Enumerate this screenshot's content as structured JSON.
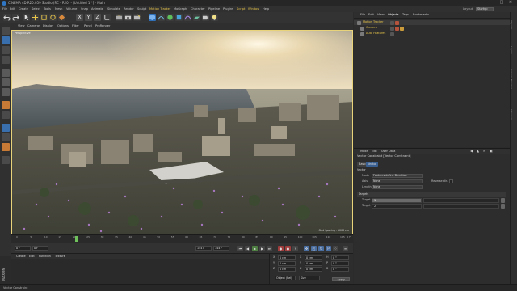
{
  "window": {
    "title": "CINEMA 4D R20.059 Studio (RC - R20) - [Untitled 1 *] - Main",
    "minimize": "–",
    "maximize": "□",
    "close": "×"
  },
  "menubar": {
    "items": [
      "File",
      "Edit",
      "Create",
      "Select",
      "Tools",
      "Mesh",
      "Volume",
      "Snap",
      "Animate",
      "Simulate",
      "Render",
      "Sculpt",
      "Motion Tracker",
      "MoGraph",
      "Character",
      "Pipeline",
      "Plugins",
      "Script",
      "Window",
      "Help"
    ],
    "highlighted": [
      "Motion Tracker",
      "Script",
      "Window"
    ],
    "layout_label": "Layout:",
    "layout_value": "Startup"
  },
  "toolbar": {
    "axis_x": "X",
    "axis_y": "Y",
    "axis_z": "Z"
  },
  "viewport": {
    "menu": [
      "View",
      "Cameras",
      "Display",
      "Options",
      "Filter",
      "Panel",
      "ProRender"
    ],
    "camera_label": "Perspective",
    "grid_spacing": "Grid Spacing : 1000 cm"
  },
  "timeline": {
    "ticks": [
      "0",
      "5",
      "10",
      "15",
      "20",
      "25",
      "30",
      "35",
      "40",
      "45",
      "50",
      "55",
      "60",
      "65",
      "70",
      "75",
      "80",
      "85",
      "90",
      "95",
      "100",
      "105",
      "110",
      "115"
    ],
    "playhead_frame": 21,
    "end_label": "0 F",
    "start_field": "0 F",
    "current_field": "0 F",
    "end_field": "144 F",
    "end_field2": "144 F"
  },
  "materials": {
    "menu": [
      "Create",
      "Edit",
      "Function",
      "Texture"
    ]
  },
  "coords": {
    "rows": [
      {
        "axis": "X",
        "value": "0 cm",
        "axis2": "X",
        "value2": "0 cm",
        "axis3": "H",
        "value3": "0 °"
      },
      {
        "axis": "Y",
        "value": "0 cm",
        "axis2": "Y",
        "value2": "0 cm",
        "axis3": "P",
        "value3": "0 °"
      },
      {
        "axis": "Z",
        "value": "0 cm",
        "axis2": "Z",
        "value2": "0 cm",
        "axis3": "B",
        "value3": "0 °"
      }
    ],
    "mode_select": "Object (Rel)",
    "size_select": "Size",
    "apply": "Apply"
  },
  "status": {
    "message": "Vector Constraint"
  },
  "brand": "MAXON",
  "objects": {
    "tabs": [
      "File",
      "Edit",
      "View",
      "Objects",
      "Tags",
      "Bookmarks"
    ],
    "active_tab": "Objects",
    "rows": [
      {
        "name": "Motion Tracker",
        "color": "#e8c64a"
      },
      {
        "name": "Camera",
        "color": "#e8c64a"
      },
      {
        "name": "Auto Features",
        "color": "#e8c64a"
      }
    ]
  },
  "attributes": {
    "menu": [
      "Mode",
      "Edit",
      "User Data"
    ],
    "title": "Vector Constraint [Vector Constraint]",
    "tabs": [
      "Basic",
      "Vector"
    ],
    "active_tab": "Vector",
    "section": "Vector",
    "mode_label": "Mode",
    "mode_value": "Features define Direction",
    "axis_label": "Axis",
    "axis_value": "None",
    "length_label": "Length",
    "length_value": "None",
    "reverse_label": "Reverse dir.",
    "targets_section": "Targets",
    "target_label": "Target",
    "target_label2": "Target",
    "target_value": "1",
    "target_value2": "2"
  },
  "right_strip": [
    "Objects",
    "Layers",
    "Content Browser",
    "Structure"
  ],
  "colors": {
    "accent": "#e8c64a",
    "viewport_border": "#e8d27a",
    "playhead": "#6fc25b",
    "active_tab": "#3a5f91"
  }
}
